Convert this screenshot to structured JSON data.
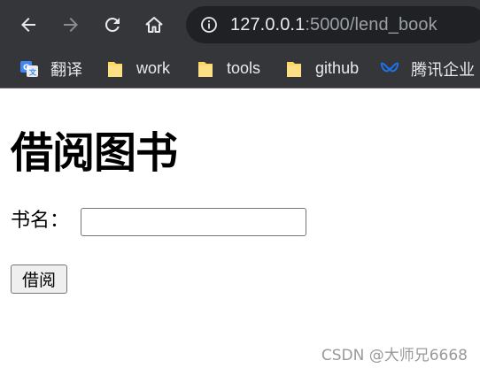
{
  "browser": {
    "address_bar": {
      "host": "127.0.0.1",
      "path": ":5000/lend_book"
    },
    "bookmarks": [
      {
        "label": "翻译",
        "icon": "translate-icon"
      },
      {
        "label": "work",
        "icon": "folder-icon"
      },
      {
        "label": "tools",
        "icon": "folder-icon"
      },
      {
        "label": "github",
        "icon": "folder-icon"
      },
      {
        "label": "腾讯企业",
        "icon": "tencent-logo-icon"
      }
    ]
  },
  "page": {
    "title": "借阅图书",
    "form": {
      "book_label": "书名：",
      "book_value": "",
      "submit_label": "借阅"
    },
    "watermark": "CSDN @大师兄6668"
  },
  "colors": {
    "chrome_bg": "#35363a",
    "omnibox_bg": "#202124",
    "folder_yellow": "#fdd663",
    "tencent_blue": "#1a73e8"
  }
}
